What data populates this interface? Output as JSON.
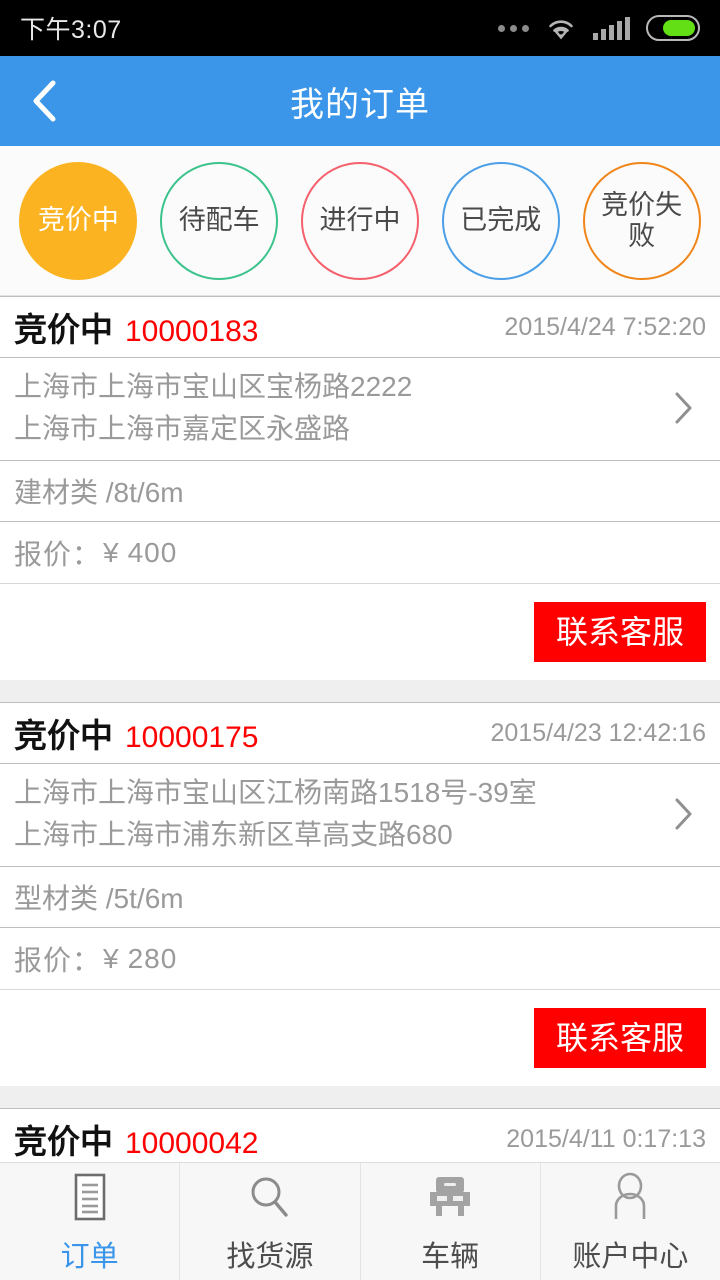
{
  "statusbar": {
    "time": "下午3:07",
    "icons": [
      "more-dots-icon",
      "wifi-icon",
      "signal-icon",
      "battery-icon"
    ]
  },
  "navbar": {
    "back_icon": "chevron-left-icon",
    "title": "我的订单"
  },
  "filters": [
    {
      "label": "竞价中",
      "active": true,
      "color": "#fbb321"
    },
    {
      "label": "待配车",
      "active": false,
      "color": "#3bc38b"
    },
    {
      "label": "进行中",
      "active": false,
      "color": "#f4606c"
    },
    {
      "label": "已完成",
      "active": false,
      "color": "#4a9fe8"
    },
    {
      "label": "竞价失败",
      "active": false,
      "color": "#f08519"
    }
  ],
  "list": {
    "price_label": "报价：",
    "currency": "¥",
    "contact_label": "联系客服",
    "chevron_icon": "chevron-right-icon",
    "orders": [
      {
        "status": "竞价中",
        "id": "10000183",
        "time": "2015/4/24 7:52:20",
        "from": "上海市上海市宝山区宝杨路2222",
        "to": "上海市上海市嘉定区永盛路",
        "cargo": "建材类 /8t/6m",
        "price": "400"
      },
      {
        "status": "竞价中",
        "id": "10000175",
        "time": "2015/4/23 12:42:16",
        "from": "上海市上海市宝山区江杨南路1518号-39室",
        "to": "上海市上海市浦东新区草高支路680",
        "cargo": "型材类 /5t/6m",
        "price": "280"
      },
      {
        "status": "竞价中",
        "id": "10000042",
        "time": "2015/4/11 0:17:13",
        "from": "",
        "to": "",
        "cargo": "",
        "price": ""
      }
    ]
  },
  "tabbar": {
    "items": [
      {
        "label": "订单",
        "icon": "document-icon",
        "active": true
      },
      {
        "label": "找货源",
        "icon": "search-icon",
        "active": false
      },
      {
        "label": "车辆",
        "icon": "truck-icon",
        "active": false
      },
      {
        "label": "账户中心",
        "icon": "person-icon",
        "active": false
      }
    ]
  },
  "colors": {
    "navbar": "#3b95e8",
    "accent_red": "#ff0000",
    "active_tab": "#3b95e8",
    "page_bg": "#efefef"
  }
}
